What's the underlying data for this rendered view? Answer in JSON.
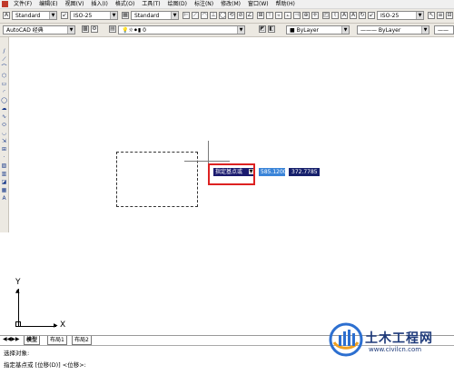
{
  "menu": {
    "items": [
      "文件(F)",
      "编辑(E)",
      "视图(V)",
      "插入(I)",
      "格式(O)",
      "工具(T)",
      "绘图(D)",
      "标注(N)",
      "修改(M)",
      "窗口(W)",
      "帮助(H)"
    ]
  },
  "toolbar1": {
    "text_style": "Standard",
    "dim_style": "ISO-25",
    "table_style": "Standard",
    "mleader_style": "ISO-25"
  },
  "toolbar2": {
    "workspace": "AutoCAD 经典",
    "layer": "0",
    "color": "ByLayer",
    "linetype": "ByLayer"
  },
  "dynamic_input": {
    "prompt": "指定基点或",
    "x_value": "585.1200",
    "y_value": "372.7785"
  },
  "ucs": {
    "x_label": "X",
    "y_label": "Y"
  },
  "tabs": [
    "模型",
    "布局1",
    "布局2"
  ],
  "command_line": {
    "line1": "选择对象:",
    "line2": "指定基点或 [位移(D)] <位移>:"
  },
  "watermark": {
    "title": "土木工程网",
    "url": "www.civilcn.com"
  },
  "colors": {
    "prompt_bg": "#1a1a6e",
    "x_value_bg": "#3a84d8",
    "y_value_bg": "#16206c",
    "highlight_border": "#dd2222"
  }
}
